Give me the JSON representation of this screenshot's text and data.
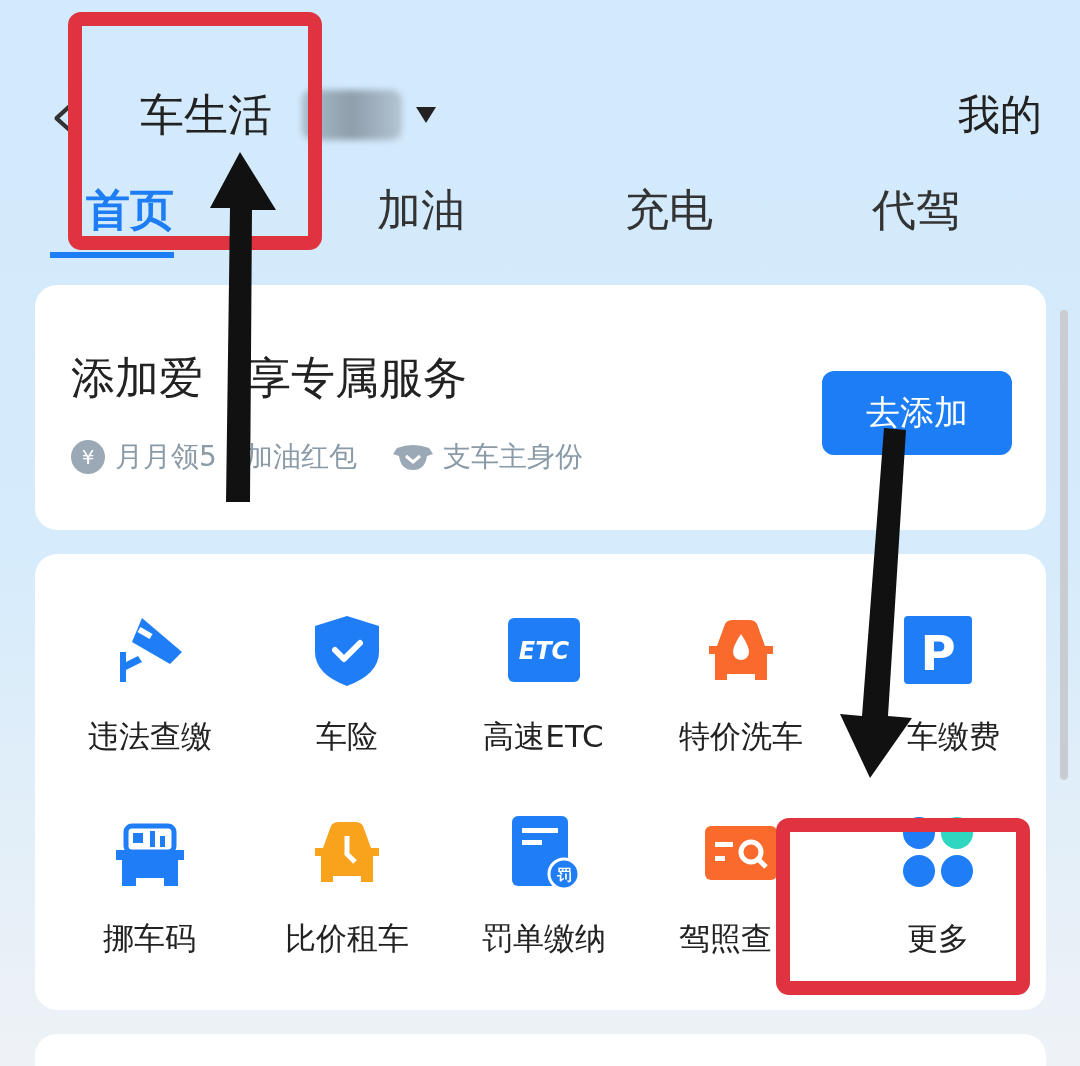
{
  "header": {
    "back": "‹",
    "title": "车生活",
    "mine": "我的"
  },
  "tabs": [
    {
      "label": "首页",
      "selected": true
    },
    {
      "label": "加油",
      "selected": false
    },
    {
      "label": "充电",
      "selected": false
    },
    {
      "label": "代驾",
      "selected": false
    }
  ],
  "car_card": {
    "title_parts": [
      "添加爱",
      "享专属服务"
    ],
    "perks": [
      {
        "kind": "coin",
        "icon_text": "¥",
        "label_parts": [
          "月月领5",
          "加油红包"
        ]
      },
      {
        "kind": "badge",
        "label_parts": [
          "支车主身份"
        ]
      }
    ],
    "button": "去添加"
  },
  "services": [
    {
      "kind": "camera",
      "label": "违法查缴"
    },
    {
      "kind": "shield",
      "label": "车险"
    },
    {
      "kind": "etc",
      "icon_text": "ETC",
      "label": "高速ETC"
    },
    {
      "kind": "car-drop",
      "label": "特价洗车"
    },
    {
      "kind": "parking",
      "icon_text": "P",
      "label": "车缴费",
      "hidden_lead": true
    },
    {
      "kind": "car-code",
      "label": "挪车码"
    },
    {
      "kind": "car-clock",
      "label": "比价租车"
    },
    {
      "kind": "ticket",
      "icon_text": "罚",
      "label": "罚单缴纳"
    },
    {
      "kind": "card-search",
      "label": "驾照查",
      "hidden_tail": true
    },
    {
      "kind": "dots",
      "label": "更多"
    }
  ]
}
